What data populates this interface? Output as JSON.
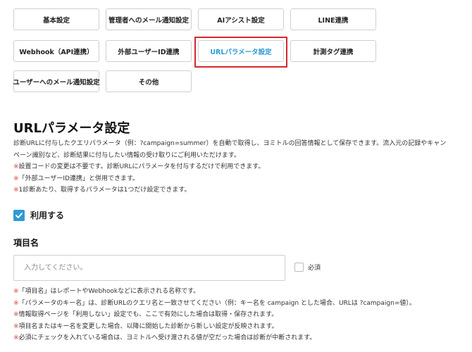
{
  "tabs": [
    {
      "label": "基本設定"
    },
    {
      "label": "管理者へのメール通知設定"
    },
    {
      "label": "AIアシスト設定"
    },
    {
      "label": "LINE連携"
    },
    {
      "label": "Webhook（API連携）"
    },
    {
      "label": "外部ユーザーID連携"
    },
    {
      "label": "URLパラメータ設定",
      "active": true
    },
    {
      "label": "計測タグ連携"
    },
    {
      "label": "ユーザーへのメール通知設定"
    },
    {
      "label": "その他"
    }
  ],
  "colors": {
    "accent": "#2c9bd6",
    "highlight": "#d9262c",
    "note_mark": "#e0413a"
  },
  "section": {
    "title": "URLパラメータ設定",
    "description_1": "診断URLに付与したクエリパラメータ（例：?campaign=summer）を自動で取得し、ヨミトルの回答情報として保存できます。流入元の記録やキャン",
    "description_2": "ペーン識別など、診断結果に付与したい情報の受け取りにご利用いただけます。",
    "note_mark": "※",
    "notes_top": [
      "設置コードの変更は不要です。診断URLにパラメータを付与するだけで利用できます。",
      "「外部ユーザーID連携」と併用できます。",
      "1診断あたり、取得するパラメータは1つだけ設定できます。"
    ]
  },
  "enable": {
    "label": "利用する",
    "checked": true,
    "icon": "check-icon"
  },
  "field": {
    "title": "項目名",
    "placeholder": "入力してください。",
    "required_label": "必須",
    "notes": [
      "「項目名」はレポートやWebhookなどに表示される名称です。",
      "「パラメータのキー名」は、診断URLのクエリ名と一致させてください（例：キー名を campaign とした場合、URLは ?campaign=値）。",
      "情報取得ページを「利用しない」設定でも、ここで有効にした場合は取得・保存されます。",
      "項目名またはキー名を変更した場合、以降に開始した診断から新しい設定が反映されます。",
      "必須にチェックを入れている場合は、ヨミトルへ受け渡される値が空だった場合は診断が中断されます。"
    ]
  }
}
